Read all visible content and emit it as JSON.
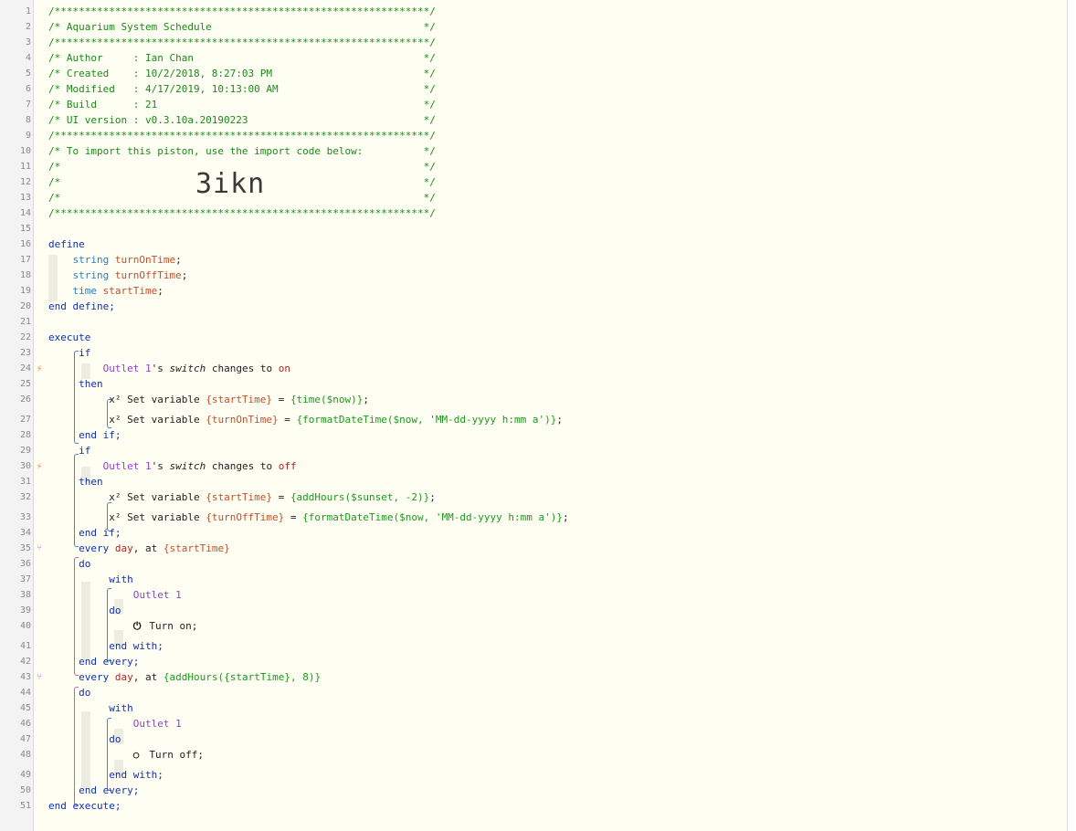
{
  "import_code": "3ikn",
  "lines": [
    {
      "n": "1",
      "parts": [
        {
          "c": "cm",
          "t": "/**************************************************************/"
        }
      ]
    },
    {
      "n": "2",
      "parts": [
        {
          "c": "cm",
          "t": "/* Aquarium System Schedule                                   */"
        }
      ]
    },
    {
      "n": "3",
      "parts": [
        {
          "c": "cm",
          "t": "/**************************************************************/"
        }
      ]
    },
    {
      "n": "4",
      "parts": [
        {
          "c": "cm",
          "t": "/* Author     : Ian Chan                                      */"
        }
      ]
    },
    {
      "n": "5",
      "parts": [
        {
          "c": "cm",
          "t": "/* Created    : 10/2/2018, 8:27:03 PM                         */"
        }
      ]
    },
    {
      "n": "6",
      "parts": [
        {
          "c": "cm",
          "t": "/* Modified   : 4/17/2019, 10:13:00 AM                        */"
        }
      ]
    },
    {
      "n": "7",
      "parts": [
        {
          "c": "cm",
          "t": "/* Build      : 21                                            */"
        }
      ]
    },
    {
      "n": "8",
      "parts": [
        {
          "c": "cm",
          "t": "/* UI version : v0.3.10a.20190223                             */"
        }
      ]
    },
    {
      "n": "9",
      "parts": [
        {
          "c": "cm",
          "t": "/**************************************************************/"
        }
      ]
    },
    {
      "n": "10",
      "parts": [
        {
          "c": "cm",
          "t": "/* To import this piston, use the import code below:          */"
        }
      ]
    },
    {
      "n": "11",
      "parts": [
        {
          "c": "cm",
          "t": "/*                                                            */"
        }
      ]
    },
    {
      "n": "12",
      "parts": [
        {
          "c": "cm",
          "t": "/*                                                            */"
        }
      ]
    },
    {
      "n": "13",
      "parts": [
        {
          "c": "cm",
          "t": "/*                                                            */"
        }
      ]
    },
    {
      "n": "14",
      "parts": [
        {
          "c": "cm",
          "t": "/**************************************************************/"
        }
      ]
    },
    {
      "n": "15",
      "parts": []
    },
    {
      "n": "16",
      "parts": [
        {
          "c": "kw",
          "t": "define"
        }
      ]
    },
    {
      "n": "17",
      "parts": [
        {
          "c": "pl",
          "t": "    "
        },
        {
          "c": "ty",
          "t": "string "
        },
        {
          "c": "vr",
          "t": "turnOnTime"
        },
        {
          "c": "pl",
          "t": ";"
        }
      ]
    },
    {
      "n": "18",
      "parts": [
        {
          "c": "pl",
          "t": "    "
        },
        {
          "c": "ty",
          "t": "string "
        },
        {
          "c": "vr",
          "t": "turnOffTime"
        },
        {
          "c": "pl",
          "t": ";"
        }
      ]
    },
    {
      "n": "19",
      "parts": [
        {
          "c": "pl",
          "t": "    "
        },
        {
          "c": "ty",
          "t": "time "
        },
        {
          "c": "vr",
          "t": "startTime"
        },
        {
          "c": "pl",
          "t": ";"
        }
      ]
    },
    {
      "n": "20",
      "parts": [
        {
          "c": "kw",
          "t": "end define;"
        }
      ]
    },
    {
      "n": "21",
      "parts": []
    },
    {
      "n": "22",
      "parts": [
        {
          "c": "kw",
          "t": "execute"
        }
      ]
    },
    {
      "n": "23",
      "parts": [
        {
          "c": "pl",
          "t": "     "
        },
        {
          "c": "kw",
          "t": "if"
        }
      ]
    },
    {
      "n": "24",
      "parts": [
        {
          "c": "pl",
          "t": "         "
        },
        {
          "c": "dv",
          "t": "Outlet 1"
        },
        {
          "c": "pl",
          "t": "'s "
        },
        {
          "c": "at",
          "t": "switch"
        },
        {
          "c": "pl",
          "t": " changes to "
        },
        {
          "c": "st",
          "t": "on"
        }
      ]
    },
    {
      "n": "25",
      "parts": [
        {
          "c": "pl",
          "t": "     "
        },
        {
          "c": "kw",
          "t": "then"
        }
      ]
    },
    {
      "n": "26",
      "parts": [
        {
          "c": "pl",
          "t": "          "
        },
        {
          "c": "x2",
          "t": "x²"
        },
        {
          "c": "pl",
          "t": " Set variable "
        },
        {
          "c": "vr",
          "t": "{startTime}"
        },
        {
          "c": "pl",
          "t": " = "
        },
        {
          "c": "ex",
          "t": "{time($now)}"
        },
        {
          "c": "pl",
          "t": ";"
        }
      ]
    },
    {
      "n": "27",
      "parts": [
        {
          "c": "pl",
          "t": "          "
        },
        {
          "c": "x2",
          "t": "x²"
        },
        {
          "c": "pl",
          "t": " Set variable "
        },
        {
          "c": "vr",
          "t": "{turnOnTime}"
        },
        {
          "c": "pl",
          "t": " = "
        },
        {
          "c": "ex",
          "t": "{formatDateTime($now, 'MM-dd-yyyy h:mm a')}"
        },
        {
          "c": "pl",
          "t": ";"
        }
      ]
    },
    {
      "n": "28",
      "parts": [
        {
          "c": "pl",
          "t": "     "
        },
        {
          "c": "kw",
          "t": "end if;"
        }
      ]
    },
    {
      "n": "29",
      "parts": [
        {
          "c": "pl",
          "t": "     "
        },
        {
          "c": "kw",
          "t": "if"
        }
      ]
    },
    {
      "n": "30",
      "parts": [
        {
          "c": "pl",
          "t": "         "
        },
        {
          "c": "dv",
          "t": "Outlet 1"
        },
        {
          "c": "pl",
          "t": "'s "
        },
        {
          "c": "at",
          "t": "switch"
        },
        {
          "c": "pl",
          "t": " changes to "
        },
        {
          "c": "st",
          "t": "off"
        }
      ]
    },
    {
      "n": "31",
      "parts": [
        {
          "c": "pl",
          "t": "     "
        },
        {
          "c": "kw",
          "t": "then"
        }
      ]
    },
    {
      "n": "32",
      "parts": [
        {
          "c": "pl",
          "t": "          "
        },
        {
          "c": "x2",
          "t": "x²"
        },
        {
          "c": "pl",
          "t": " Set variable "
        },
        {
          "c": "vr",
          "t": "{startTime}"
        },
        {
          "c": "pl",
          "t": " = "
        },
        {
          "c": "ex",
          "t": "{addHours($sunset, -2)}"
        },
        {
          "c": "pl",
          "t": ";"
        }
      ]
    },
    {
      "n": "33",
      "parts": [
        {
          "c": "pl",
          "t": "          "
        },
        {
          "c": "x2",
          "t": "x²"
        },
        {
          "c": "pl",
          "t": " Set variable "
        },
        {
          "c": "vr",
          "t": "{turnOffTime}"
        },
        {
          "c": "pl",
          "t": " = "
        },
        {
          "c": "ex",
          "t": "{formatDateTime($now, 'MM-dd-yyyy h:mm a')}"
        },
        {
          "c": "pl",
          "t": ";"
        }
      ]
    },
    {
      "n": "34",
      "parts": [
        {
          "c": "pl",
          "t": "     "
        },
        {
          "c": "kw",
          "t": "end if;"
        }
      ]
    },
    {
      "n": "35",
      "parts": [
        {
          "c": "pl",
          "t": "     "
        },
        {
          "c": "kw",
          "t": "every "
        },
        {
          "c": "st",
          "t": "day"
        },
        {
          "c": "pl",
          "t": ", at "
        },
        {
          "c": "vr",
          "t": "{startTime}"
        }
      ]
    },
    {
      "n": "36",
      "parts": [
        {
          "c": "pl",
          "t": "     "
        },
        {
          "c": "kw",
          "t": "do"
        }
      ]
    },
    {
      "n": "37",
      "parts": [
        {
          "c": "pl",
          "t": "          "
        },
        {
          "c": "kw",
          "t": "with"
        }
      ]
    },
    {
      "n": "38",
      "parts": [
        {
          "c": "pl",
          "t": "              "
        },
        {
          "c": "dv",
          "t": "Outlet 1"
        }
      ]
    },
    {
      "n": "39",
      "parts": [
        {
          "c": "pl",
          "t": "          "
        },
        {
          "c": "kw",
          "t": "do"
        }
      ]
    },
    {
      "n": "40",
      "parts": [
        {
          "c": "pl",
          "t": "              "
        },
        {
          "c": "pwr",
          "t": "⏻"
        },
        {
          "c": "pl",
          "t": " Turn on;"
        }
      ]
    },
    {
      "n": "41",
      "parts": [
        {
          "c": "pl",
          "t": "          "
        },
        {
          "c": "kw",
          "t": "end with;"
        }
      ]
    },
    {
      "n": "42",
      "parts": [
        {
          "c": "pl",
          "t": "     "
        },
        {
          "c": "kw",
          "t": "end every;"
        }
      ]
    },
    {
      "n": "43",
      "parts": [
        {
          "c": "pl",
          "t": "     "
        },
        {
          "c": "kw",
          "t": "every "
        },
        {
          "c": "st",
          "t": "day"
        },
        {
          "c": "pl",
          "t": ", at "
        },
        {
          "c": "ex",
          "t": "{addHours({startTime}, 8)}"
        }
      ]
    },
    {
      "n": "44",
      "parts": [
        {
          "c": "pl",
          "t": "     "
        },
        {
          "c": "kw",
          "t": "do"
        }
      ]
    },
    {
      "n": "45",
      "parts": [
        {
          "c": "pl",
          "t": "          "
        },
        {
          "c": "kw",
          "t": "with"
        }
      ]
    },
    {
      "n": "46",
      "parts": [
        {
          "c": "pl",
          "t": "              "
        },
        {
          "c": "dv",
          "t": "Outlet 1"
        }
      ]
    },
    {
      "n": "47",
      "parts": [
        {
          "c": "pl",
          "t": "          "
        },
        {
          "c": "kw",
          "t": "do"
        }
      ]
    },
    {
      "n": "48",
      "parts": [
        {
          "c": "pl",
          "t": "              "
        },
        {
          "c": "pwr",
          "t": "○"
        },
        {
          "c": "pl",
          "t": " Turn off;"
        }
      ]
    },
    {
      "n": "49",
      "parts": [
        {
          "c": "pl",
          "t": "          "
        },
        {
          "c": "kw",
          "t": "end with;"
        }
      ]
    },
    {
      "n": "50",
      "parts": [
        {
          "c": "pl",
          "t": "     "
        },
        {
          "c": "kw",
          "t": "end every;"
        }
      ]
    },
    {
      "n": "51",
      "parts": [
        {
          "c": "kw",
          "t": "end execute;"
        }
      ]
    }
  ],
  "gutter_icons": [
    {
      "line": "24",
      "icon": "bolt-icon",
      "glyph": "⚡"
    },
    {
      "line": "30",
      "icon": "bolt-icon",
      "glyph": "⚡"
    },
    {
      "line": "35",
      "icon": "timer-fork-icon",
      "glyph": "⑂"
    },
    {
      "line": "43",
      "icon": "timer-fork-icon",
      "glyph": "⑂"
    }
  ]
}
